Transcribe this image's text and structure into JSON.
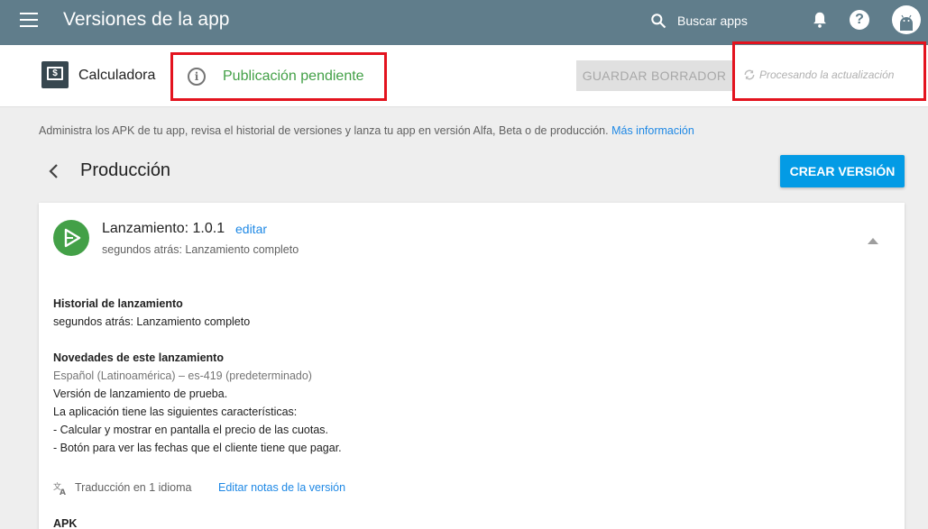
{
  "topbar": {
    "title": "Versiones de la app",
    "search_label": "Buscar apps"
  },
  "appbar": {
    "app_name": "Calculadora",
    "status": "Publicación pendiente",
    "save_draft_label": "GUARDAR BORRADOR",
    "processing_text": "Procesando la actualización"
  },
  "content": {
    "description": "Administra los APK de tu app, revisa el historial de versiones y lanza tu app en versión Alfa, Beta o de producción. ",
    "more_info": "Más información",
    "section_title": "Producción",
    "create_button": "CREAR VERSIÓN"
  },
  "release": {
    "title": "Lanzamiento: 1.0.1",
    "edit_label": "editar",
    "subtitle": "segundos atrás: Lanzamiento completo",
    "history_heading": "Historial de lanzamiento",
    "history_text": "segundos atrás: Lanzamiento completo",
    "news_heading": "Novedades de este lanzamiento",
    "language": "Español (Latinoamérica) – es-419 (predeterminado)",
    "notes": [
      "Versión de lanzamiento de prueba.",
      "La aplicación tiene las siguientes características:",
      "- Calcular y mostrar en pantalla el precio de las cuotas.",
      "- Botón para ver las fechas que el cliente tiene que pagar."
    ],
    "translation_text": "Traducción en 1 idioma",
    "edit_notes": "Editar notas de la versión",
    "apk_heading": "APK"
  },
  "colors": {
    "topbar": "#607d8b",
    "status_green": "#43a047",
    "highlight_red": "#e3131e",
    "link_blue": "#1e88e5",
    "button_blue": "#039be5"
  },
  "icons": [
    "menu-icon",
    "search-icon",
    "bell-icon",
    "help-icon",
    "android-avatar-icon",
    "info-icon",
    "refresh-icon",
    "back-chevron-icon",
    "release-play-icon",
    "chevron-up-icon",
    "translate-icon"
  ]
}
